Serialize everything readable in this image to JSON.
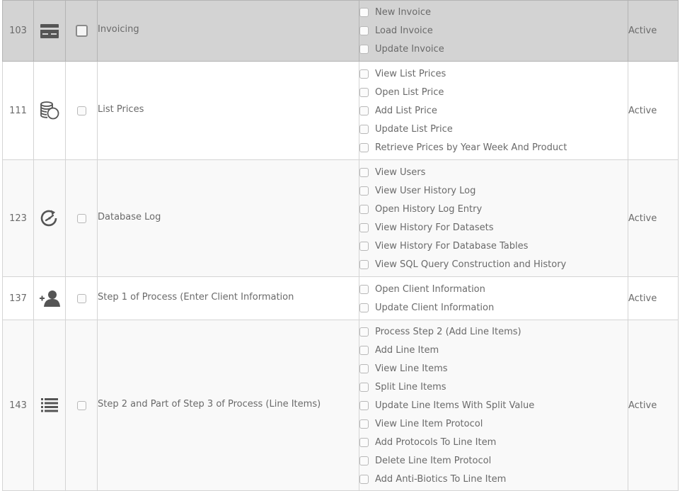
{
  "rows": [
    {
      "id": "103",
      "icon": "credit-card-icon",
      "name": "Invoicing",
      "status": "Active",
      "permissions": [
        "New Invoice",
        "Load Invoice",
        "Update Invoice"
      ]
    },
    {
      "id": "111",
      "icon": "coins-icon",
      "name": "List Prices",
      "status": "Active",
      "permissions": [
        "View List Prices",
        "Open List Price",
        "Add List Price",
        "Update List Price",
        "Retrieve Prices by Year Week And Product"
      ]
    },
    {
      "id": "123",
      "icon": "history-clock-icon",
      "name": "Database Log",
      "status": "Active",
      "permissions": [
        "View Users",
        "View User History Log",
        "Open History Log Entry",
        "View History For Datasets",
        "View History For Database Tables",
        "View SQL Query Construction and History"
      ]
    },
    {
      "id": "137",
      "icon": "add-user-icon",
      "name": "Step 1 of Process (Enter Client Information",
      "status": "Active",
      "permissions": [
        "Open Client Information",
        "Update Client Information"
      ]
    },
    {
      "id": "143",
      "icon": "list-icon",
      "name": "Step 2 and Part of Step 3 of Process (Line Items)",
      "status": "Active",
      "permissions": [
        "Process Step 2 (Add Line Items)",
        "Add Line Item",
        "View Line Items",
        "Split Line Items",
        "Update Line Items With Split Value",
        "View Line Item Protocol",
        "Add Protocols To Line Item",
        "Delete Line Item Protocol",
        "Add Anti-Biotics To Line Item"
      ]
    }
  ]
}
